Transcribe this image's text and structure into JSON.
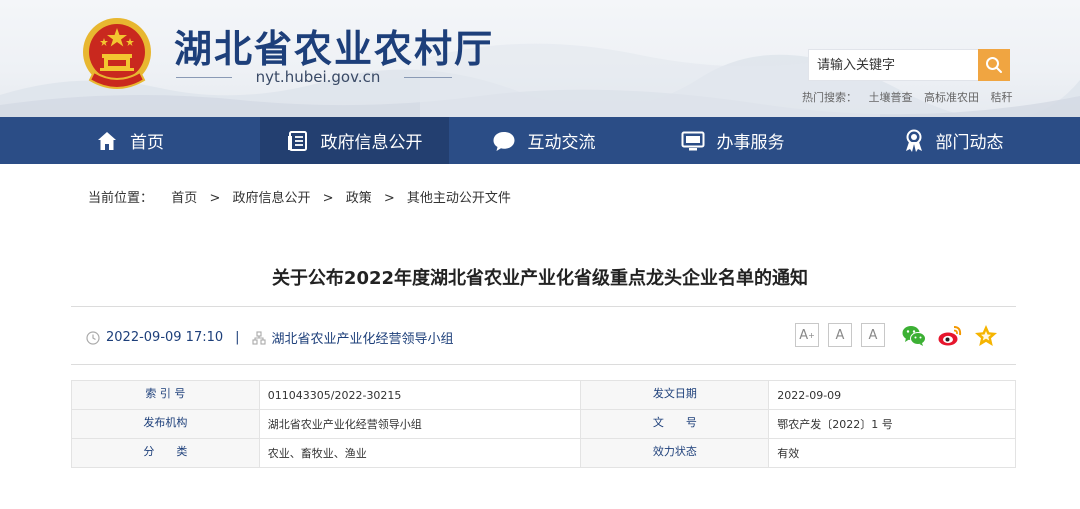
{
  "header": {
    "site_title": "湖北省农业农村厅",
    "site_domain": "nyt.hubei.gov.cn",
    "search_placeholder": "请输入关键字",
    "hot_label": "热门搜索：",
    "hot_words": [
      "土壤普查",
      "高标准农田",
      "秸秆"
    ]
  },
  "nav": {
    "items": [
      {
        "label": "首页",
        "icon": "home-icon"
      },
      {
        "label": "政府信息公开",
        "icon": "document-icon"
      },
      {
        "label": "互动交流",
        "icon": "chat-bubble-icon"
      },
      {
        "label": "办事服务",
        "icon": "monitor-icon"
      },
      {
        "label": "部门动态",
        "icon": "award-ribbon-icon"
      }
    ],
    "active_index": 1
  },
  "breadcrumb": {
    "label": "当前位置：",
    "items": [
      "首页",
      "政府信息公开",
      "政策",
      "其他主动公开文件"
    ],
    "separator": ">"
  },
  "article": {
    "title": "关于公布2022年度湖北省农业产业化省级重点龙头企业名单的通知",
    "datetime": "2022-09-09 17:10",
    "meta_separator": "|",
    "source": "湖北省农业产业化经营领导小组"
  },
  "font_controls": [
    "A+",
    "A",
    "A-"
  ],
  "share": [
    "wechat-icon",
    "weibo-icon",
    "favorite-star-icon"
  ],
  "info_table": {
    "rows": [
      {
        "l1": "索 引 号",
        "v1": "011043305/2022-30215",
        "l2": "发文日期",
        "v2": "2022-09-09"
      },
      {
        "l1": "发布机构",
        "v1": "湖北省农业产业化经营领导小组",
        "l2": "文　　号",
        "v2": "鄂农产发〔2022〕1 号"
      },
      {
        "l1": "分　　类",
        "v1": "农业、畜牧业、渔业",
        "l2": "效力状态",
        "v2": "有效"
      }
    ]
  },
  "colors": {
    "nav_bg": "#2b4d86",
    "nav_active": "#233f70",
    "brand_blue": "#1d3f7a",
    "search_button": "#f0a541"
  }
}
